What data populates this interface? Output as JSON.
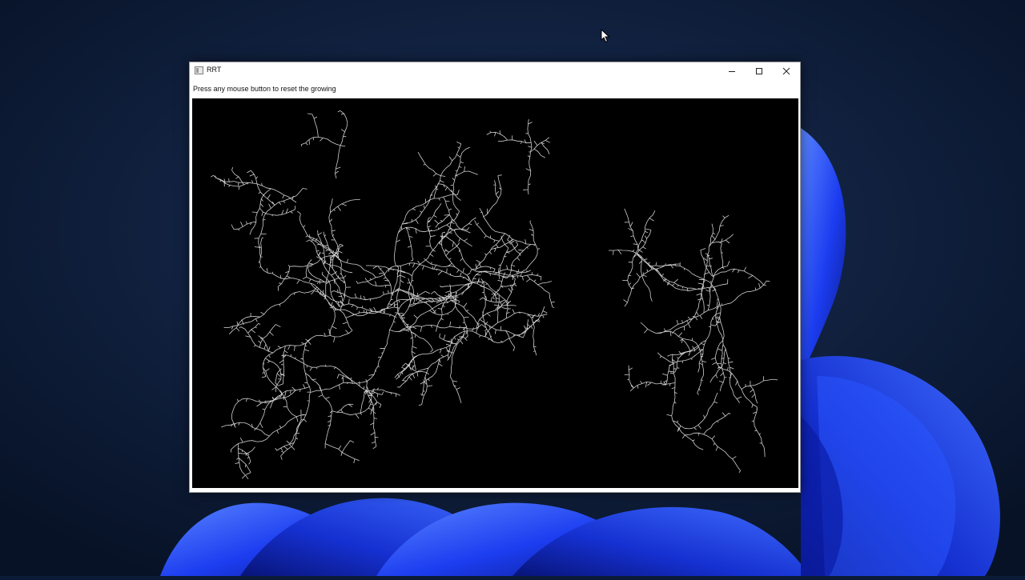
{
  "window": {
    "title": "RRT",
    "subtitle": "Press any mouse button to reset the growing"
  },
  "controls": {
    "minimize_icon": "minimize-icon",
    "maximize_icon": "maximize-icon",
    "close_icon": "close-icon"
  },
  "colors": {
    "desktop_background": "#0b1a36",
    "wallpaper_bloom": "#1f3fff",
    "canvas_background": "#000000",
    "tree_color": "#cfcfcf"
  },
  "icons": {
    "cursor": "arrow-cursor-icon",
    "app": "app-window-icon"
  }
}
